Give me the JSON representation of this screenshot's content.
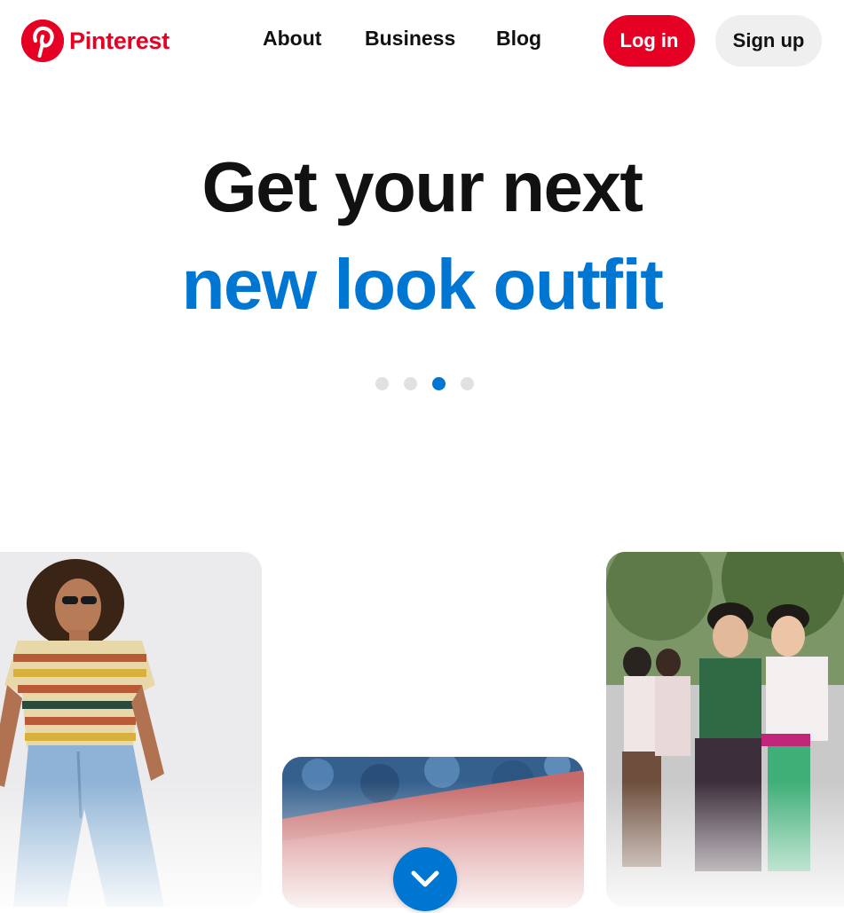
{
  "header": {
    "logo_text": "Pinterest",
    "nav": {
      "about": "About",
      "business": "Business",
      "blog": "Blog"
    },
    "login_label": "Log in",
    "signup_label": "Sign up"
  },
  "hero": {
    "line1": "Get your next",
    "line2": "new look outfit",
    "carousel": {
      "slides": 4,
      "active_index": 3
    }
  },
  "icons": {
    "logo": "pinterest-logo-icon",
    "scroll": "chevron-down-icon"
  },
  "colors": {
    "brand_red": "#e60023",
    "accent_blue": "#0076d3",
    "signup_bg": "#efefef",
    "text": "#111111"
  }
}
